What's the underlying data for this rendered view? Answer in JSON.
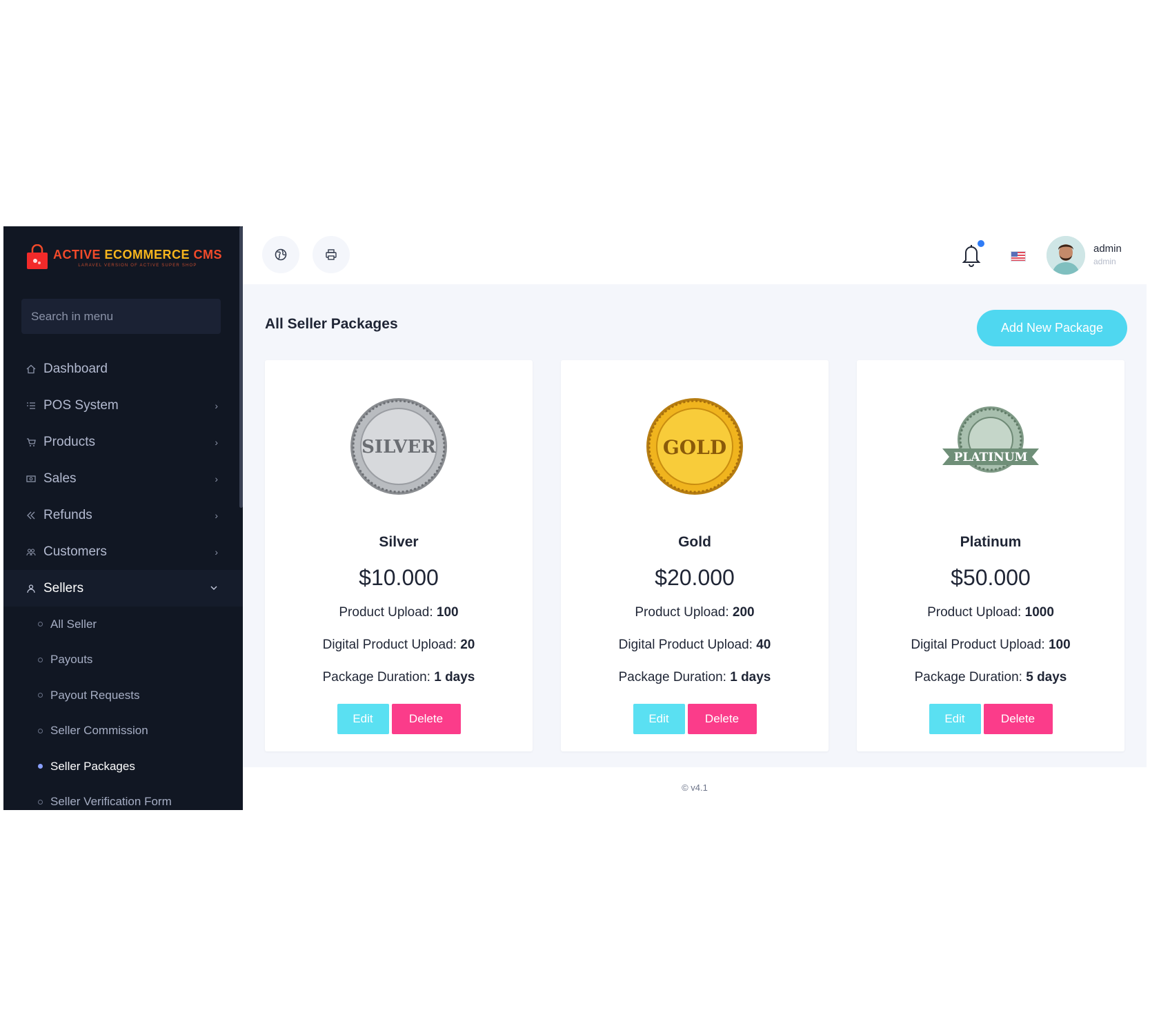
{
  "brand": {
    "title_part1": "ACTIVE ",
    "title_part2": "ECOMMERCE",
    "title_part3": " CMS",
    "subtitle": "LARAVEL VERSION OF ACTIVE SUPER SHOP"
  },
  "sidebar": {
    "search_placeholder": "Search in menu",
    "items": [
      {
        "label": "Dashboard",
        "icon": "home-icon",
        "has_children": false
      },
      {
        "label": "POS System",
        "icon": "list-icon",
        "has_children": true
      },
      {
        "label": "Products",
        "icon": "cart-icon",
        "has_children": true
      },
      {
        "label": "Sales",
        "icon": "money-icon",
        "has_children": true
      },
      {
        "label": "Refunds",
        "icon": "backward-icon",
        "has_children": true
      },
      {
        "label": "Customers",
        "icon": "users-icon",
        "has_children": true
      },
      {
        "label": "Sellers",
        "icon": "user-icon",
        "has_children": true,
        "expanded": true
      }
    ],
    "sellers_submenu": [
      {
        "label": "All Seller",
        "active": false
      },
      {
        "label": "Payouts",
        "active": false
      },
      {
        "label": "Payout Requests",
        "active": false
      },
      {
        "label": "Seller Commission",
        "active": false
      },
      {
        "label": "Seller Packages",
        "active": true
      },
      {
        "label": "Seller Verification Form",
        "active": false
      }
    ]
  },
  "topbar": {
    "icons": [
      "globe-icon",
      "printer-icon"
    ],
    "notification_icon": "bell-icon",
    "language_flag": "us-flag-icon",
    "user_name": "admin",
    "user_role": "admin"
  },
  "page": {
    "title": "All Seller Packages",
    "add_button": "Add New Package"
  },
  "packages": [
    {
      "name": "Silver",
      "badge_text": "SILVER",
      "price": "$10.000",
      "product_upload_label": "Product Upload:",
      "product_upload": "100",
      "digital_upload_label": "Digital Product Upload:",
      "digital_upload": "20",
      "duration_label": "Package Duration:",
      "duration": "1 days",
      "edit_label": "Edit",
      "delete_label": "Delete"
    },
    {
      "name": "Gold",
      "badge_text": "GOLD",
      "price": "$20.000",
      "product_upload_label": "Product Upload:",
      "product_upload": "200",
      "digital_upload_label": "Digital Product Upload:",
      "digital_upload": "40",
      "duration_label": "Package Duration:",
      "duration": "1 days",
      "edit_label": "Edit",
      "delete_label": "Delete"
    },
    {
      "name": "Platinum",
      "badge_text": "PLATINUM",
      "price": "$50.000",
      "product_upload_label": "Product Upload:",
      "product_upload": "1000",
      "digital_upload_label": "Digital Product Upload:",
      "digital_upload": "100",
      "duration_label": "Package Duration:",
      "duration": "5 days",
      "edit_label": "Edit",
      "delete_label": "Delete"
    }
  ],
  "footer": {
    "text": "© v4.1"
  },
  "colors": {
    "sidebar_bg": "#111723",
    "accent_cyan": "#4fd7f0",
    "delete_pink": "#fb3c8a",
    "brand_red": "#f24a2a"
  }
}
